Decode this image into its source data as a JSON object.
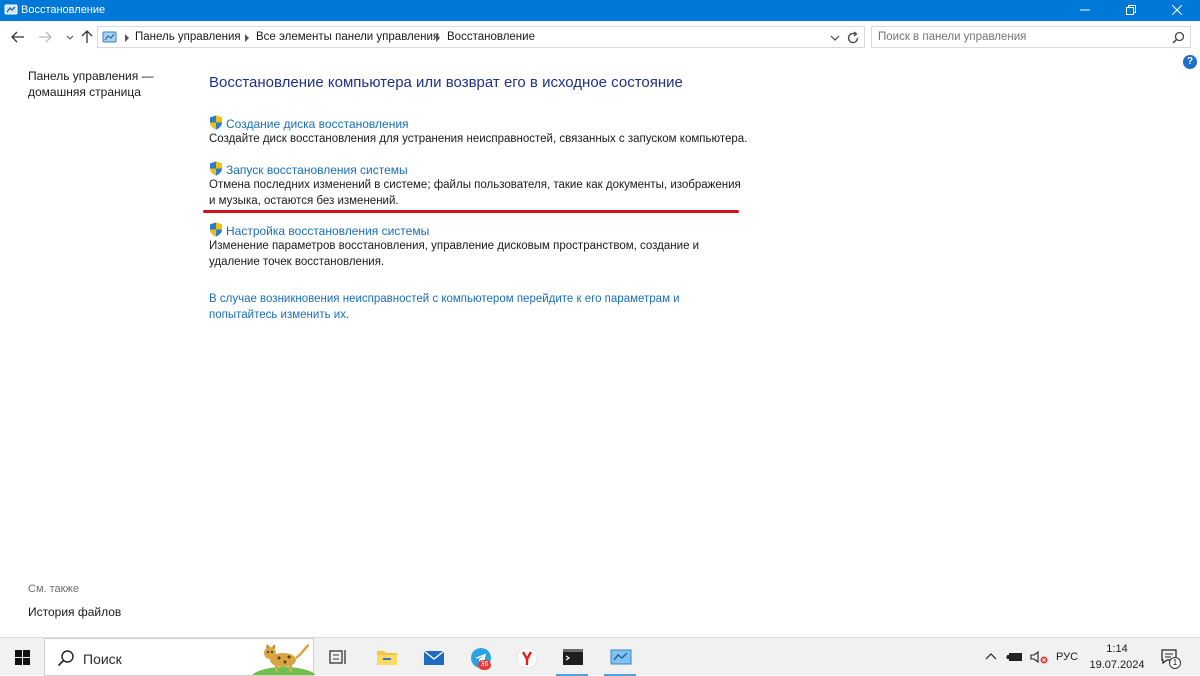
{
  "window": {
    "title": "Восстановление"
  },
  "address": {
    "breadcrumbs": [
      "Панель управления",
      "Все элементы панели управления",
      "Восстановление"
    ]
  },
  "search": {
    "placeholder": "Поиск в панели управления"
  },
  "left_pane": {
    "home_link": "Панель управления — домашняя страница",
    "see_also_label": "См. также",
    "file_history": "История файлов"
  },
  "main": {
    "heading": "Восстановление компьютера или возврат его в исходное состояние",
    "items": [
      {
        "title": "Создание диска восстановления",
        "desc": "Создайте диск восстановления для устранения неисправностей, связанных с запуском компьютера."
      },
      {
        "title": "Запуск восстановления системы",
        "desc": "Отмена последних изменений в системе; файлы пользователя, такие как документы, изображения и музыка, остаются без изменений."
      },
      {
        "title": "Настройка восстановления системы",
        "desc": "Изменение параметров восстановления, управление дисковым пространством, создание и удаление точек восстановления."
      }
    ],
    "bottom_link": "В случае возникновения неисправностей с компьютером перейдите к его параметрам и попытайтесь изменить их."
  },
  "taskbar": {
    "search_label": "Поиск",
    "telegram_badge": "36",
    "lang": "РУС",
    "time": "1:14",
    "date": "19.07.2024",
    "notifications_count": "1"
  },
  "colors": {
    "accent": "#0078d7",
    "link": "#1a6fb8",
    "heading": "#1e3287",
    "highlight": "#d0121b"
  }
}
